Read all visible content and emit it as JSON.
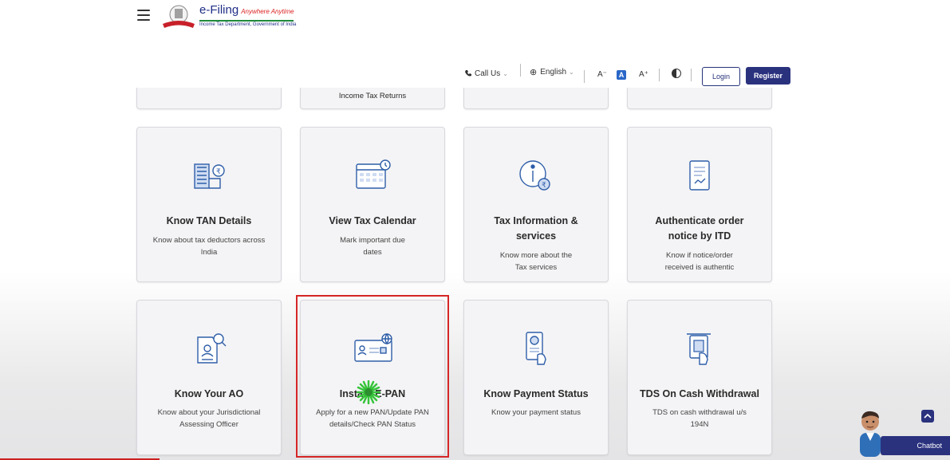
{
  "header": {
    "logo_title": "e-Filing",
    "logo_tagline": "Anywhere Anytime",
    "logo_subtitle": "Income Tax Department, Government of India",
    "call_label": "Call Us",
    "language_label": "English",
    "font_decrease": "A⁻",
    "font_default": "A",
    "font_increase": "A⁺",
    "login_label": "Login",
    "register_label": "Register"
  },
  "top_partial_cards": [
    {
      "title": ""
    },
    {
      "title": "Income Tax Returns"
    },
    {
      "title": ""
    },
    {
      "title": ""
    }
  ],
  "cards_row1": [
    {
      "title": "Know TAN Details",
      "desc": "Know about tax deductors across India",
      "icon": "building-rupee-icon"
    },
    {
      "title": "View Tax Calendar",
      "desc": "Mark important due dates",
      "icon": "calendar-clock-icon"
    },
    {
      "title": "Tax Information & services",
      "desc": "Know more about the Tax services",
      "icon": "info-rupee-icon"
    },
    {
      "title": "Authenticate order notice by ITD",
      "desc": "Know if notice/order received is authentic",
      "icon": "document-check-icon"
    }
  ],
  "cards_row2": [
    {
      "title": "Know Your AO",
      "desc": "Know about your Jurisdictional Assessing Officer",
      "icon": "document-search-icon"
    },
    {
      "title": "Instant E-PAN",
      "desc": "Apply for a new PAN/Update PAN details/Check PAN Status",
      "icon": "id-card-globe-icon"
    },
    {
      "title": "Know Payment Status",
      "desc": "Know your payment status",
      "icon": "phone-payment-icon"
    },
    {
      "title": "TDS On Cash Withdrawal",
      "desc": "TDS on cash withdrawal u/s 194N",
      "icon": "atm-cash-icon"
    }
  ],
  "chatbot": {
    "label": "Chatbot"
  },
  "colors": {
    "brand_navy": "#2a327e",
    "highlight_red": "#d52626",
    "icon_blue": "#2f5ea8"
  }
}
